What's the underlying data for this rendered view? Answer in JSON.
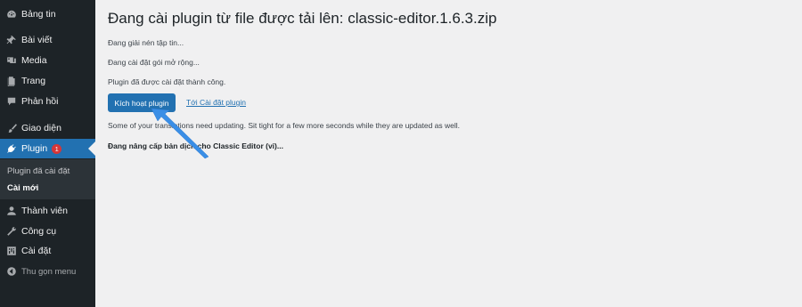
{
  "sidebar": {
    "items": [
      {
        "label": "Bảng tin",
        "icon": "dashboard-icon"
      },
      {
        "label": "Bài viết",
        "icon": "pin-icon"
      },
      {
        "label": "Media",
        "icon": "media-icon"
      },
      {
        "label": "Trang",
        "icon": "page-icon"
      },
      {
        "label": "Phản hồi",
        "icon": "comment-icon"
      },
      {
        "label": "Giao diện",
        "icon": "brush-icon"
      },
      {
        "label": "Plugin",
        "icon": "plugin-icon",
        "badge": "1"
      },
      {
        "label": "Thành viên",
        "icon": "user-icon"
      },
      {
        "label": "Công cụ",
        "icon": "wrench-icon"
      },
      {
        "label": "Cài đặt",
        "icon": "settings-icon"
      }
    ],
    "submenu": [
      {
        "label": "Plugin đã cài đặt"
      },
      {
        "label": "Cài mới"
      }
    ],
    "collapse_label": "Thu gọn menu"
  },
  "main": {
    "title": "Đang cài plugin từ file được tải lên: classic-editor.1.6.3.zip",
    "log": [
      "Đang giải nén tập tin...",
      "Đang cài đặt gói mở rộng...",
      "Plugin đã được cài đặt thành công."
    ],
    "activate_button": "Kích hoạt plugin",
    "settings_link": "Tới Cài đặt plugin",
    "translation_note": "Some of your translations need updating. Sit tight for a few more seconds while they are updated as well.",
    "translation_status": "Đang nâng cấp bản dịch cho Classic Editor (vi)..."
  },
  "colors": {
    "sidebar_bg": "#1d2327",
    "accent": "#2271b1",
    "badge": "#d63638",
    "content_bg": "#f0f0f1",
    "annotation_arrow": "#3a8ee6"
  }
}
